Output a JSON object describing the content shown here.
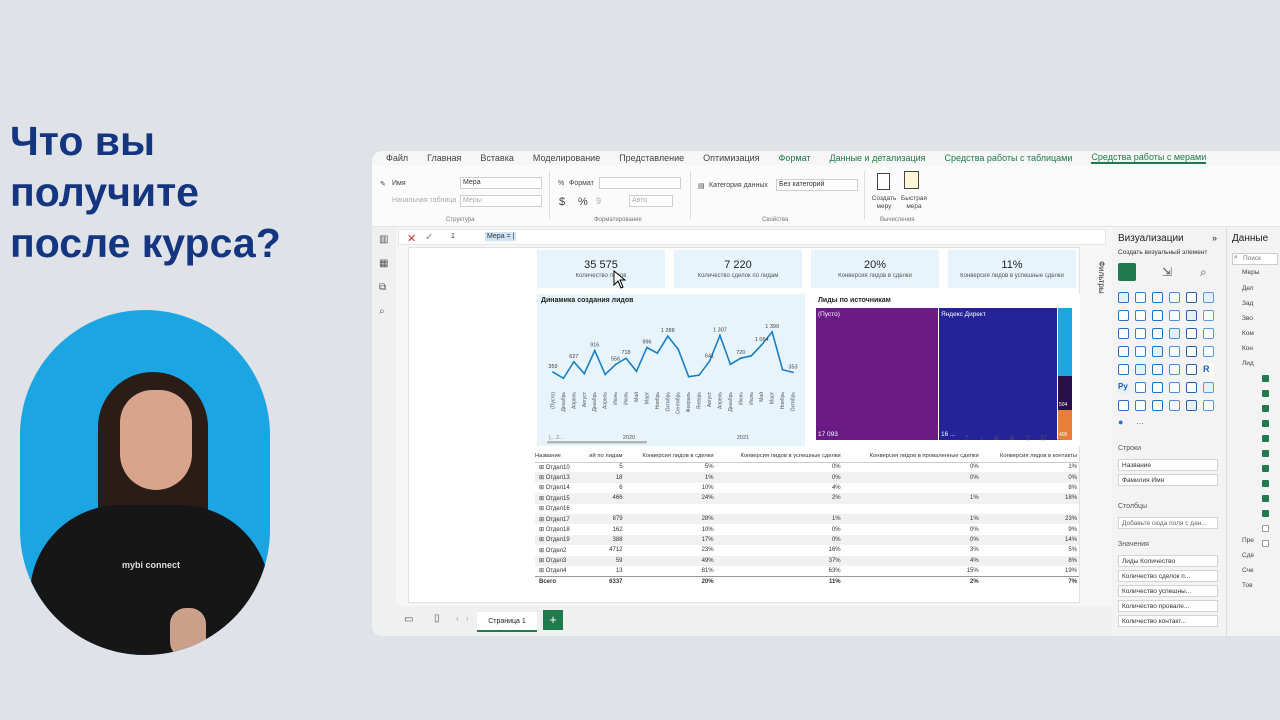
{
  "headline": {
    "line1": "Что вы",
    "line2": "получите",
    "line3": "после курса?"
  },
  "presenter": {
    "shirt_text": "mybi connect"
  },
  "menu": [
    "Файл",
    "Главная",
    "Вставка",
    "Моделирование",
    "Представление",
    "Оптимизация",
    "Формат",
    "Данные и детализация",
    "Средства работы с таблицами",
    "Средства работы с мерами"
  ],
  "ribbon": {
    "name_label": "Имя",
    "name_value": "Мера",
    "home_table_label": "Начальная таблица",
    "home_table_value": "Меры",
    "format_label": "Формат",
    "auto_value": "Авто",
    "category_label": "Категория данных",
    "category_value": "Без категорий",
    "new_measure": "Создать меру",
    "quick_measure": "Быстрая мера",
    "group_structure": "Структура",
    "group_formatting": "Форматирование",
    "group_properties": "Свойства",
    "group_calc": "Вычисления",
    "dollar": "$",
    "percent": "%",
    "comma": "9"
  },
  "formula": {
    "line_no": "1",
    "text": "Мера = |"
  },
  "cards": [
    {
      "value": "35 575",
      "label": "Количество лидов"
    },
    {
      "value": "7 220",
      "label": "Количество сделок по лидам"
    },
    {
      "value": "20%",
      "label": "Конверсия лидов в сделки"
    },
    {
      "value": "11%",
      "label": "Конверсия лидов в успешные сделки"
    }
  ],
  "line_chart": {
    "title": "Динамика создания лидов",
    "year_labels": [
      "2020",
      "2021"
    ],
    "year_axis_note": "(... 2..."
  },
  "treemap": {
    "title": "Лиды по источникам",
    "segments": [
      {
        "label": "(Пусто)",
        "value": "17 093",
        "color": "#6a1b85"
      },
      {
        "label": "Яндекс Директ",
        "value": "16 ...",
        "color": "#24239a"
      }
    ],
    "small_values": [
      "504",
      "405"
    ]
  },
  "chart_data": {
    "type": "line",
    "title": "Динамика создания лидов",
    "x": [
      "(Пусто)",
      "Декабрь",
      "Апрель",
      "Август",
      "Декабрь",
      "Апрель",
      "Июнь",
      "Июль",
      "Май",
      "Март",
      "Ноябрь",
      "Октябрь",
      "Сентябрь",
      "Февраль",
      "Январь",
      "Август",
      "Апрель",
      "Декабрь",
      "Июнь",
      "Июль",
      "Май",
      "Март",
      "Ноябрь",
      "Октябрь"
    ],
    "series": [
      {
        "values": [
          359,
          200,
          627,
          320,
          916,
          300,
          556,
          718,
          380,
          996,
          850,
          1288,
          950,
          240,
          280,
          640,
          1307,
          560,
          720,
          780,
          1064,
          1399,
          420,
          353
        ]
      }
    ],
    "labels_shown": [
      {
        "i": 0,
        "text": "359"
      },
      {
        "i": 2,
        "text": "627"
      },
      {
        "i": 4,
        "text": "916"
      },
      {
        "i": 6,
        "text": "556"
      },
      {
        "i": 7,
        "text": "718"
      },
      {
        "i": 9,
        "text": "996"
      },
      {
        "i": 11,
        "text": "1 288"
      },
      {
        "i": 15,
        "text": "641"
      },
      {
        "i": 16,
        "text": "1 307"
      },
      {
        "i": 18,
        "text": "720"
      },
      {
        "i": 20,
        "text": "1 064"
      },
      {
        "i": 21,
        "text": "1 399"
      },
      {
        "i": 23,
        "text": "353"
      }
    ],
    "ylim": [
      0,
      1500
    ]
  },
  "table": {
    "headers": [
      "Название",
      "ий по лидам",
      "Конверсия лидов в сделки",
      "Конверсия лидов в успешные сделки",
      "Конверсия лидов в проваленные сделки",
      "Конверсия лидов в контакты"
    ],
    "rows": [
      [
        "Отдел10",
        "5",
        "5%",
        "0%",
        "0%",
        "1%"
      ],
      [
        "Отдел13",
        "18",
        "1%",
        "0%",
        "0%",
        "0%"
      ],
      [
        "Отдел14",
        "6",
        "10%",
        "4%",
        "",
        "8%"
      ],
      [
        "Отдел15",
        "466",
        "24%",
        "2%",
        "1%",
        "18%"
      ],
      [
        "Отдел16",
        "",
        "",
        "",
        "",
        ""
      ],
      [
        "Отдел17",
        "879",
        "28%",
        "1%",
        "1%",
        "23%"
      ],
      [
        "Отдел18",
        "162",
        "10%",
        "0%",
        "0%",
        "9%"
      ],
      [
        "Отдел19",
        "388",
        "17%",
        "0%",
        "0%",
        "14%"
      ],
      [
        "Отдел2",
        "4712",
        "23%",
        "16%",
        "3%",
        "5%"
      ],
      [
        "Отдел3",
        "59",
        "49%",
        "37%",
        "4%",
        "8%"
      ],
      [
        "Отдел4",
        "13",
        "81%",
        "63%",
        "15%",
        "19%"
      ]
    ],
    "total": [
      "Всего",
      "6337",
      "20%",
      "11%",
      "2%",
      "7%"
    ]
  },
  "filters_label": "Фильтры",
  "viz_pane": {
    "title": "Визуализации",
    "subtitle": "Создать визуальный элемент",
    "rows_label": "Строки",
    "rows": [
      "Название",
      "Фамилия Имя"
    ],
    "cols_label": "Столбцы",
    "cols_placeholder": "Добавьте сюда поля с дан...",
    "values_label": "Значения",
    "values": [
      "Лиды Количество",
      "Количество сделок п...",
      "Количество успешны...",
      "Количество провале...",
      "Количество контакт..."
    ],
    "r_label": "R",
    "py_label": "Py"
  },
  "data_pane": {
    "title": "Данные",
    "search_placeholder": "Поиск",
    "items": [
      "Меры",
      "Дел",
      "Зад",
      "Зво",
      "Ком",
      "Кон",
      "Лид",
      "Пре",
      "Сде",
      "Сче",
      "Тов"
    ]
  },
  "page_tab": "Страница 1",
  "colors": {
    "accent": "#1f7a4c",
    "headline": "#14357f",
    "card_bg": "#e7f4fb",
    "line": "#1b7fc4",
    "circle": "#1ba6e3"
  }
}
